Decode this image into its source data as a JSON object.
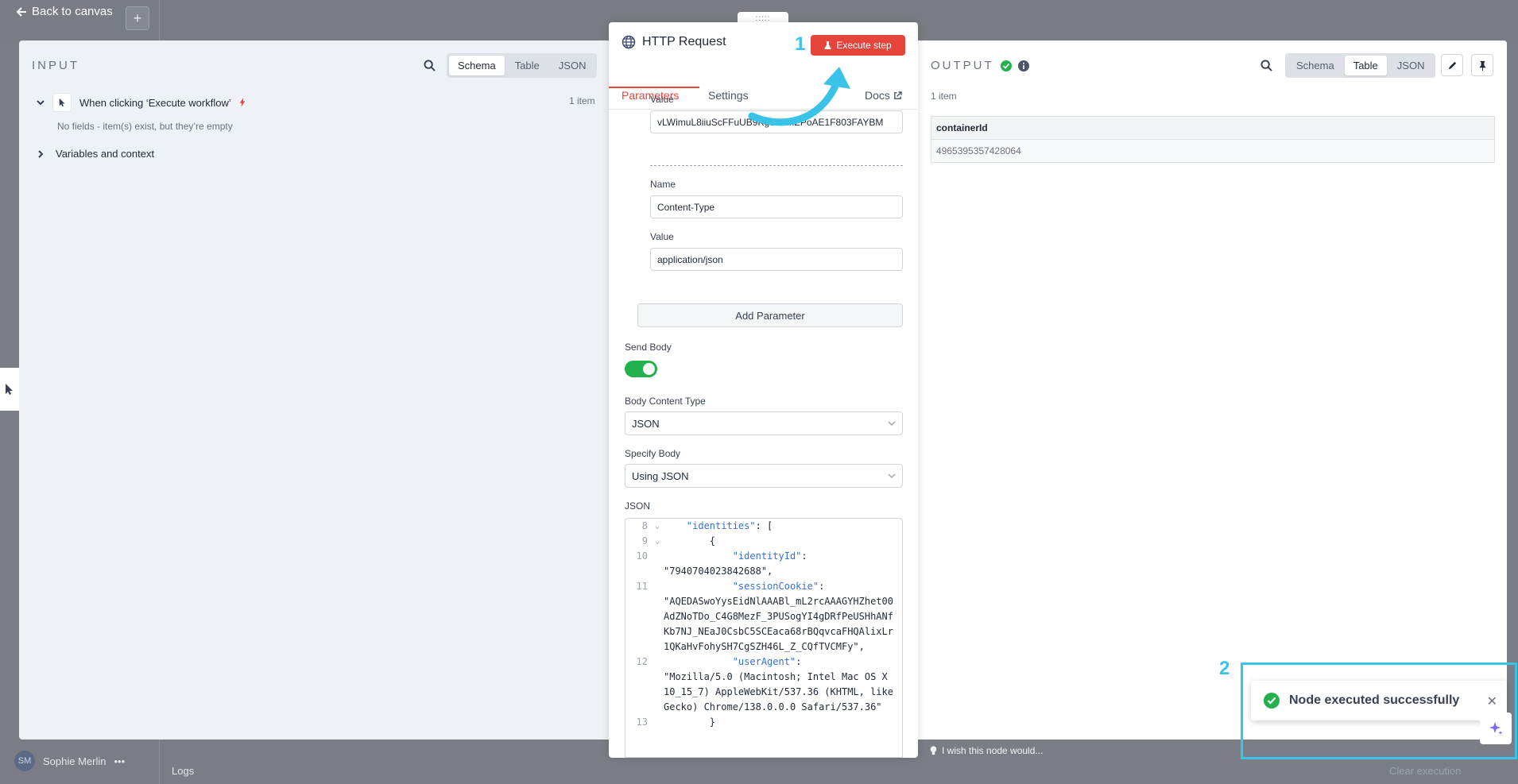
{
  "nav": {
    "back_label": "Back to canvas",
    "add_symbol": "+"
  },
  "user": {
    "initials": "SM",
    "name": "Sophie Merlin"
  },
  "footer": {
    "logs": "Logs",
    "clear": "Clear execution"
  },
  "input": {
    "title": "INPUT",
    "view_tabs": [
      "Schema",
      "Table",
      "JSON"
    ],
    "active_tab": "Schema",
    "trigger_label": "When clicking ‘Execute workflow’",
    "item_count": "1 item",
    "no_fields": "No fields - item(s) exist, but they’re empty",
    "vars_label": "Variables and context"
  },
  "node": {
    "title": "HTTP Request",
    "execute_label": "Execute step",
    "tabs": [
      "Parameters",
      "Settings"
    ],
    "docs_label": "Docs",
    "header1_value_label": "Value",
    "header1_value": "vLWimuL8iiuScFFuUB9Kg5XLMZPoAE1F803FAYBM",
    "header2_name_label": "Name",
    "header2_name": "Content-Type",
    "header2_value_label": "Value",
    "header2_value": "application/json",
    "add_param": "Add Parameter",
    "send_body_label": "Send Body",
    "body_content_type_label": "Body Content Type",
    "body_content_type": "JSON",
    "specify_body_label": "Specify Body",
    "specify_body": "Using JSON",
    "json_label": "JSON",
    "code_lines": [
      {
        "n": "8",
        "fold": true,
        "key": "\"identities\"",
        "rest": ": [",
        "indent": "    "
      },
      {
        "n": "9",
        "fold": true,
        "key": "",
        "rest": "{",
        "indent": "        "
      },
      {
        "n": "10",
        "fold": false,
        "key": "\"identityId\"",
        "rest": ":\n\"7940704023842688\",",
        "indent": "            "
      },
      {
        "n": "11",
        "fold": false,
        "key": "\"sessionCookie\"",
        "rest": ":\n\"AQEDASwoYysEidNlAAABl_mL2rcAAAGYHZhet00AdZNoTDo_C4G8MezF_3PUSogYI4gDRfPeUSHhANfKb7NJ_NEaJ0CsbC5SCEaca68rBQqvcaFHQAlixLr1QKaHvFohySH7CgSZH46L_Z_CQfTVCMFy\",",
        "indent": "            "
      },
      {
        "n": "12",
        "fold": false,
        "key": "\"userAgent\"",
        "rest": ":\n\"Mozilla/5.0 (Macintosh; Intel Mac OS X 10_15_7) AppleWebKit/537.36 (KHTML, like Gecko) Chrome/138.0.0.0 Safari/537.36\"",
        "indent": "            "
      },
      {
        "n": "13",
        "fold": false,
        "key": "",
        "rest": "}",
        "indent": "        "
      }
    ]
  },
  "output": {
    "title": "OUTPUT",
    "view_tabs": [
      "Schema",
      "Table",
      "JSON"
    ],
    "active_tab": "Table",
    "item_count": "1 item",
    "columns": [
      "containerId"
    ],
    "rows": [
      [
        "4965395357428064"
      ]
    ],
    "wish": "I wish this node would..."
  },
  "toast": {
    "message": "Node executed successfully"
  },
  "annotations": {
    "step1": "1",
    "step2": "2"
  },
  "colors": {
    "accent": "#e5443a",
    "success": "#22b14c",
    "annotation": "#39c3e8"
  }
}
